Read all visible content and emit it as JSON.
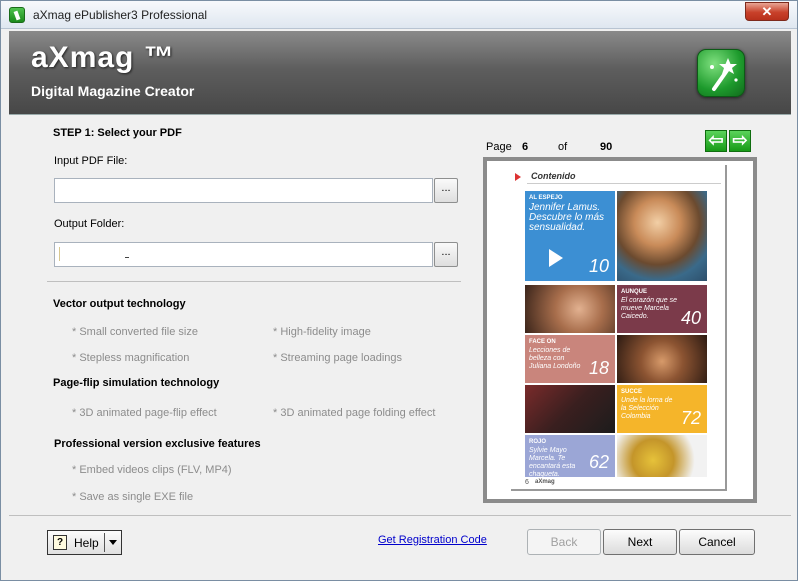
{
  "window": {
    "title": "aXmag ePublisher3 Professional",
    "close_glyph": "✕"
  },
  "banner": {
    "brand": "aXmag ™",
    "tagline": "Digital Magazine Creator",
    "logo_icon": "magic-wand-icon"
  },
  "step1": {
    "heading": "STEP 1:  Select your PDF",
    "input_label": "Input PDF File:",
    "input_value": "",
    "output_label": "Output Folder:",
    "output_value": "",
    "browse_label": "..."
  },
  "features": {
    "vector_heading": "Vector output technology",
    "vector_items": [
      "* Small converted file size",
      "* High-fidelity image",
      "* Stepless magnification",
      "* Streaming page loadings"
    ],
    "flip_heading": "Page-flip simulation technology",
    "flip_items": [
      "* 3D animated page-flip effect",
      "* 3D animated page folding effect"
    ],
    "pro_heading": "Professional version exclusive features",
    "pro_items": [
      "* Embed videos clips (FLV, MP4)",
      "* Save as single EXE file"
    ]
  },
  "preview": {
    "page_label": "Page",
    "page_current": "6",
    "of_label": "of",
    "page_total": "90",
    "prev_glyph": "⇦",
    "next_glyph": "⇨",
    "page_heading": "Contenido",
    "cells": [
      {
        "tag": "AL ESPEJO",
        "text": "Jennifer Lamus. Descubre lo más sensualidad.",
        "num": "10",
        "color": "#3c8fd3"
      },
      {
        "tag": "AUNQUE",
        "text": "El corazón que se mueve Marcela Caicedo.",
        "num": "40",
        "color": "#7b3a4a"
      },
      {
        "tag": "FACE ON",
        "text": "Lecciones de belleza con Juliana Londoño",
        "num": "18",
        "color": "#c9857c"
      },
      {
        "tag": "SUCCE",
        "text": "Unde la lorna de la Selección Colombia",
        "num": "72",
        "color": "#f5b52a"
      },
      {
        "tag": "ROJO",
        "text": "Sylvie Mayo Marcela. Te encantará esta chaqueta.",
        "num": "62",
        "color": "#9ba6d6"
      }
    ],
    "page_number": "6",
    "footer_brand": "aXmag"
  },
  "footer": {
    "help_label": "Help",
    "help_icon": "help-question-icon",
    "registration_link": "Get Registration Code",
    "back_label": "Back",
    "next_label": "Next",
    "cancel_label": "Cancel"
  }
}
